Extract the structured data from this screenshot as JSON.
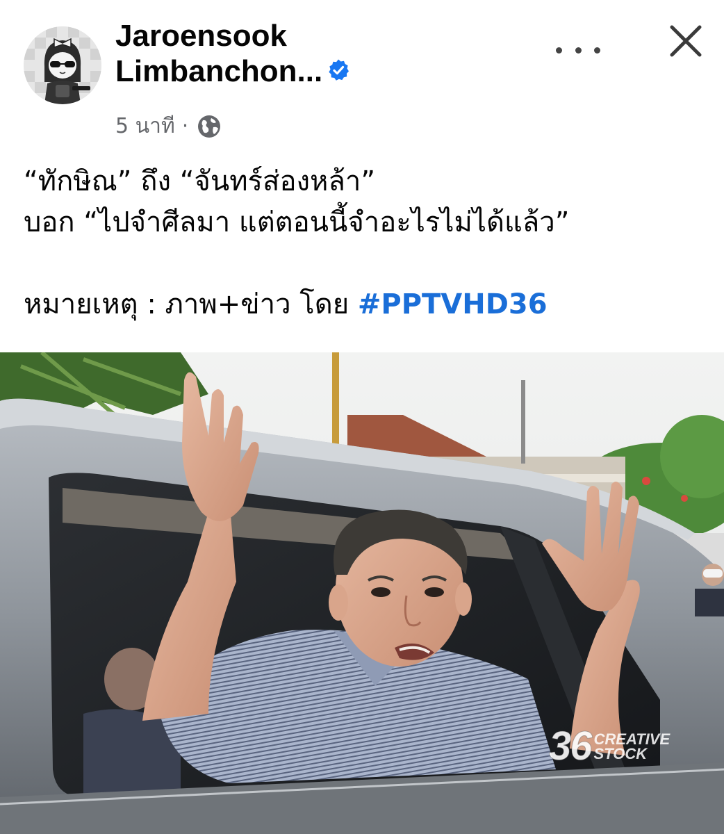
{
  "author": {
    "name_line1": "Jaroensook",
    "name_line2": "Limbanchon..."
  },
  "meta": {
    "time": "5 นาที",
    "separator": "·"
  },
  "post": {
    "lines": [
      "“ทักษิณ” ถึง “จันทร์ส่องหล้า”",
      "บอก “ไปจำศีลมา แต่ตอนนี้จำอะไรไม่ได้แล้ว”"
    ],
    "note_prefix": "หมายเหตุ : ภาพ+ข่าว โดย ",
    "hashtag": "#PPTVHD36"
  },
  "photo": {
    "watermark_number": "36",
    "watermark_word1": "CREATIVE",
    "watermark_word2": "STOCK"
  },
  "colors": {
    "hashtag": "#1a6ed8",
    "verified_badge": "#1877f2",
    "meta_text": "#65676b"
  },
  "icons": [
    "verified-badge-icon",
    "globe-icon",
    "more-options-icon",
    "close-icon"
  ]
}
